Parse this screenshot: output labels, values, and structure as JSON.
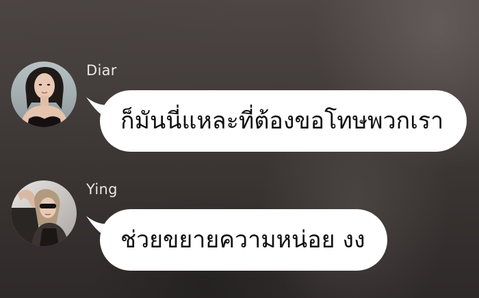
{
  "messages": [
    {
      "sender": "Diar",
      "text": "ก็มันนี่แหละที่ต้องขอโทษพวกเรา",
      "avatar": "profile-photo"
    },
    {
      "sender": "Ying",
      "text": "ช่วยขยายความหน่อย งง",
      "avatar": "profile-photo"
    }
  ],
  "colors": {
    "bubble": "#ffffff",
    "bubble_text": "#111111",
    "sender_name": "#e9e6e4",
    "background": "#3e3836"
  }
}
